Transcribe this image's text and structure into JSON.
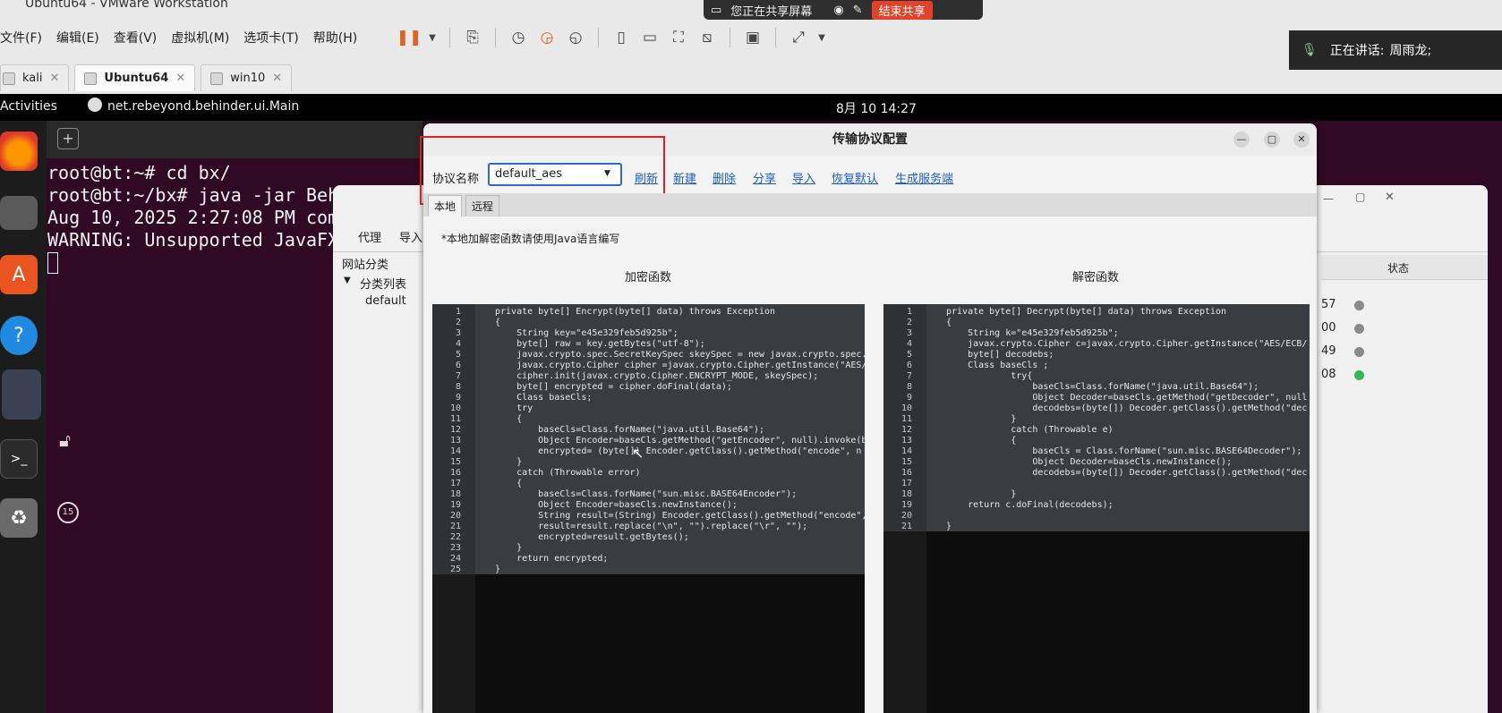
{
  "vmware": {
    "title": "Ubuntu64 - VMware Workstation",
    "menu": [
      "文件(F)",
      "编辑(E)",
      "查看(V)",
      "虚拟机(M)",
      "选项卡(T)",
      "帮助(H)"
    ],
    "tabs": [
      {
        "label": "kali",
        "active": false
      },
      {
        "label": "Ubuntu64",
        "active": true
      },
      {
        "label": "win10",
        "active": false
      }
    ]
  },
  "share_bar": {
    "text": "您正在共享屏幕",
    "stop_label": "结束共享"
  },
  "speaker": {
    "label": "正在讲话:",
    "name": "周雨龙;"
  },
  "ubuntu": {
    "activities": "Activities",
    "app_name": "net.rebeyond.behinder.ui.Main",
    "clock": "8月 10 14:27"
  },
  "dock": {
    "timer_badge": "15"
  },
  "terminal": {
    "lines": [
      "root@bt:~# cd bx/",
      "root@bt:~/bx# java -jar Beh",
      "Aug 10, 2025 2:27:08 PM com",
      "WARNING: Unsupported JavaFX"
    ]
  },
  "main_window": {
    "toolbar": [
      "代理",
      "导入"
    ],
    "site_category": "网站分类",
    "category_list": "分类列表",
    "category_default": "default",
    "status_header": "状态",
    "rows": [
      {
        "partial": "57",
        "status": "gray"
      },
      {
        "partial": "00",
        "status": "gray"
      },
      {
        "partial": "49",
        "status": "gray"
      },
      {
        "partial": "08",
        "status": "green"
      }
    ]
  },
  "dialog": {
    "title": "传输协议配置",
    "protocol_label": "协议名称",
    "protocol_value": "default_aes",
    "actions": [
      "刷新",
      "新建",
      "删除",
      "分享",
      "导入",
      "恢复默认",
      "生成服务端"
    ],
    "tabs": [
      "本地",
      "远程"
    ],
    "note": "*本地加解密函数请使用Java语言编写",
    "encrypt_title": "加密函数",
    "decrypt_title": "解密函数",
    "encrypt_code": [
      "private byte[] Encrypt(byte[] data) throws Exception",
      "{",
      "    String key=\"e45e329feb5d925b\";",
      "    byte[] raw = key.getBytes(\"utf-8\");",
      "    javax.crypto.spec.SecretKeySpec skeySpec = new javax.crypto.spec.",
      "    javax.crypto.Cipher cipher =javax.crypto.Cipher.getInstance(\"AES/",
      "    cipher.init(javax.crypto.Cipher.ENCRYPT_MODE, skeySpec);",
      "    byte[] encrypted = cipher.doFinal(data);",
      "    Class baseCls;",
      "    try",
      "    {",
      "        baseCls=Class.forName(\"java.util.Base64\");",
      "        Object Encoder=baseCls.getMethod(\"getEncoder\", null).invoke(b",
      "        encrypted= (byte[]) Encoder.getClass().getMethod(\"encode\", n",
      "    }",
      "    catch (Throwable error)",
      "    {",
      "        baseCls=Class.forName(\"sun.misc.BASE64Encoder\");",
      "        Object Encoder=baseCls.newInstance();",
      "        String result=(String) Encoder.getClass().getMethod(\"encode\",",
      "        result=result.replace(\"\\n\", \"\").replace(\"\\r\", \"\");",
      "        encrypted=result.getBytes();",
      "    }",
      "    return encrypted;",
      "}"
    ],
    "decrypt_code": [
      "private byte[] Decrypt(byte[] data) throws Exception",
      "{",
      "    String k=\"e45e329feb5d925b\";",
      "    javax.crypto.Cipher c=javax.crypto.Cipher.getInstance(\"AES/ECB/",
      "    byte[] decodebs;",
      "    Class baseCls ;",
      "            try{",
      "                baseCls=Class.forName(\"java.util.Base64\");",
      "                Object Decoder=baseCls.getMethod(\"getDecoder\", null",
      "                decodebs=(byte[]) Decoder.getClass().getMethod(\"dec",
      "            }",
      "            catch (Throwable e)",
      "            {",
      "                baseCls = Class.forName(\"sun.misc.BASE64Decoder\");",
      "                Object Decoder=baseCls.newInstance();",
      "                decodebs=(byte[]) Decoder.getClass().getMethod(\"dec",
      "",
      "            }",
      "    return c.doFinal(decodebs);",
      "",
      "}"
    ]
  }
}
